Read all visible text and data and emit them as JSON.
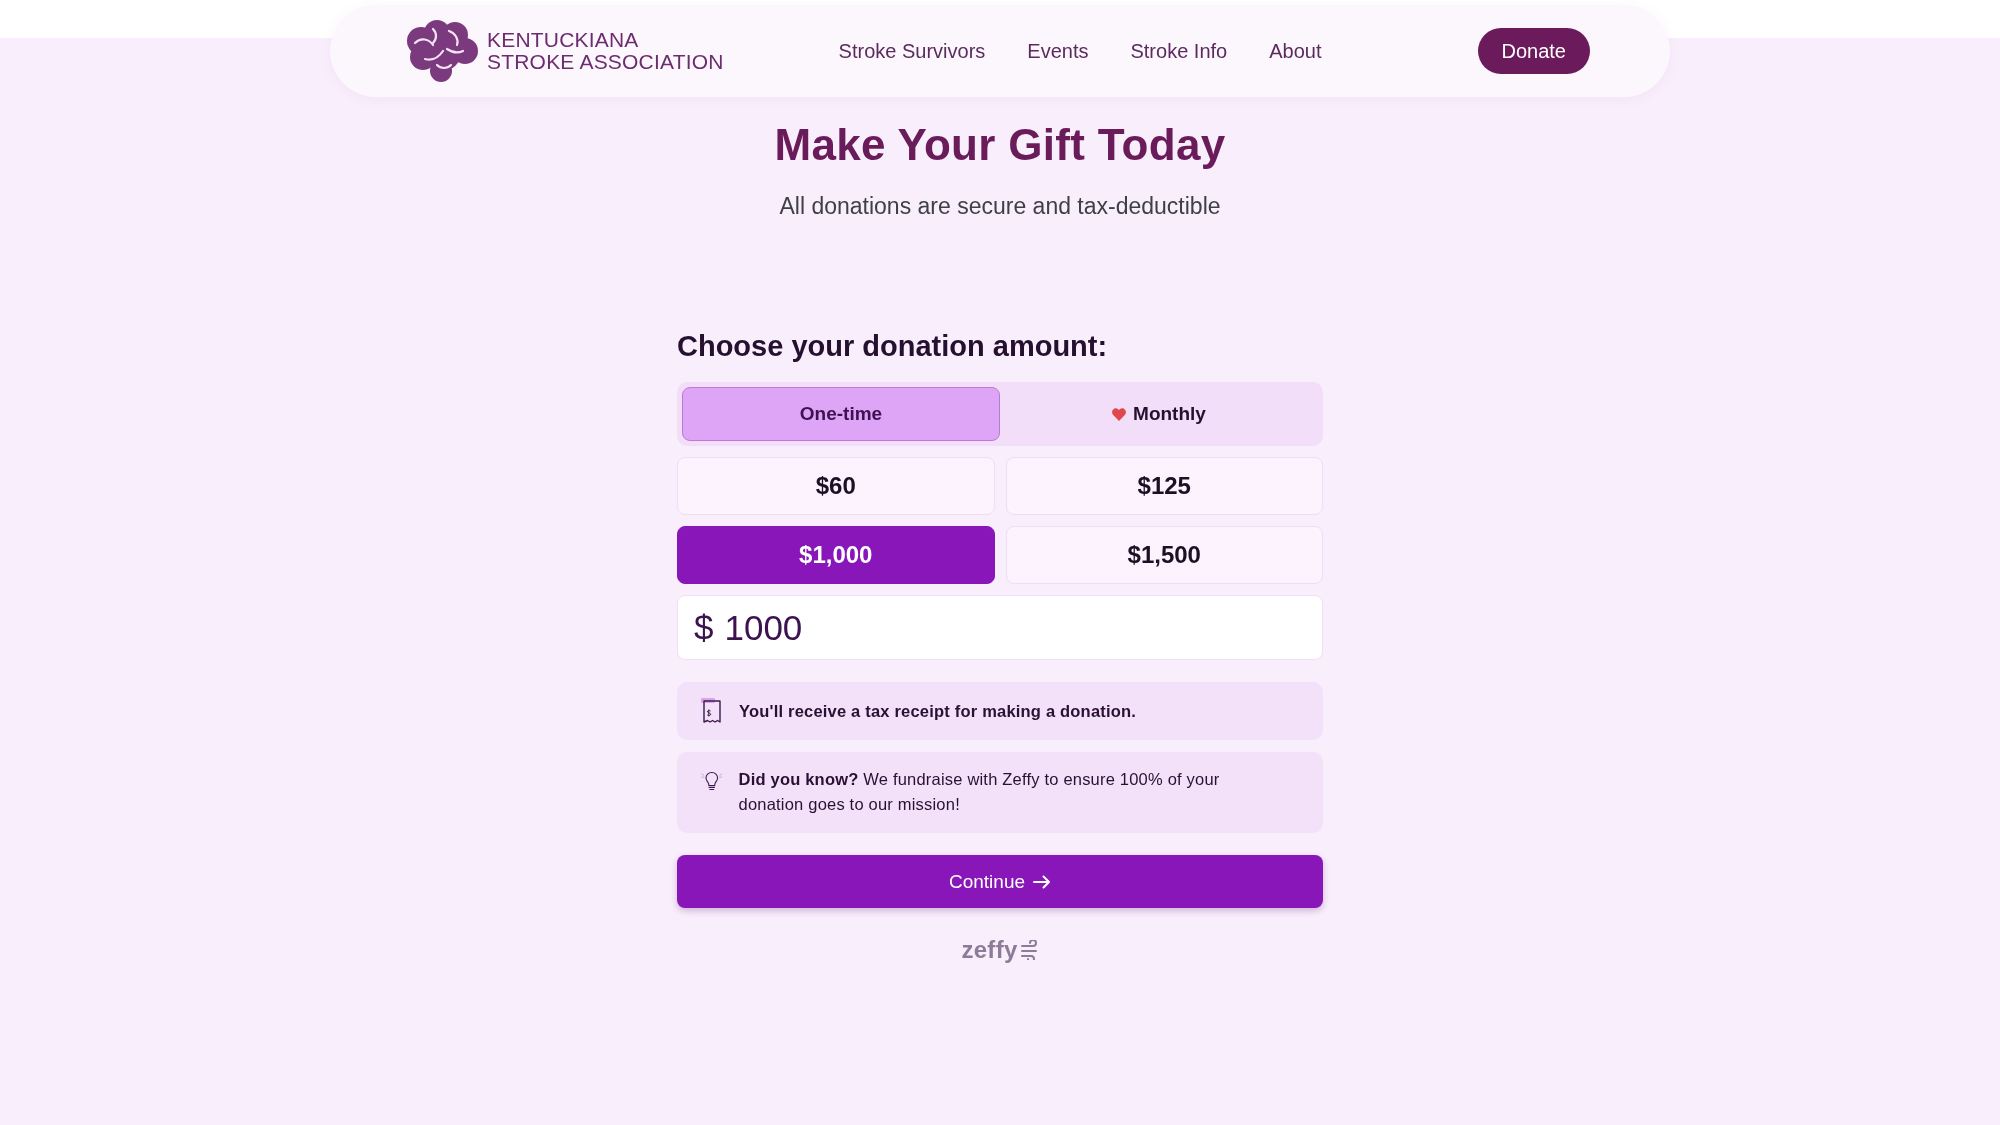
{
  "header": {
    "logo": {
      "line_1": "KENTUCKIANA",
      "line_2": "STROKE ASSOCIATION"
    },
    "nav": [
      {
        "label": "Stroke Survivors"
      },
      {
        "label": "Events"
      },
      {
        "label": "Stroke Info"
      },
      {
        "label": "About"
      }
    ],
    "donate_button": "Donate"
  },
  "hero": {
    "title": "Make Your Gift Today",
    "subtitle": "All donations are secure and tax-deductible"
  },
  "form": {
    "heading": "Choose your donation amount:",
    "frequency_tabs": [
      {
        "label": "One-time",
        "kind": "plain",
        "selected": true
      },
      {
        "label": "Monthly",
        "kind": "heart",
        "selected": false
      }
    ],
    "amounts": [
      {
        "label": "$60",
        "selected": false
      },
      {
        "label": "$125",
        "selected": false
      },
      {
        "label": "$1,000",
        "selected": true
      },
      {
        "label": "$1,500",
        "selected": false
      }
    ],
    "amount_field": {
      "currency": "$",
      "value": "1000"
    },
    "notices": [
      {
        "kind": "receipt",
        "text": "You'll receive a tax receipt for making a donation."
      },
      {
        "kind": "tip",
        "text": "**Did you know?** We fundraise with Zeffy to ensure 100% of your donation goes to our mission!"
      }
    ],
    "continue_button": "Continue",
    "footer_logo": "zeffy"
  }
}
